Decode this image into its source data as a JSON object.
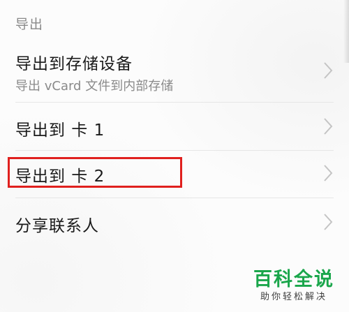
{
  "section": {
    "header": "导出"
  },
  "rows": [
    {
      "title": "导出到存储设备",
      "subtitle": "导出 vCard 文件到内部存储",
      "icon": "chevron-right-icon"
    },
    {
      "title": "导出到 卡 1",
      "icon": "chevron-right-icon"
    },
    {
      "title": "导出到 卡 2",
      "icon": "chevron-right-icon",
      "highlighted": true
    },
    {
      "title": "分享联系人",
      "icon": "chevron-right-icon"
    }
  ],
  "highlight_color": "#e0201e",
  "watermark": {
    "title": "百科全说",
    "subtitle": "助你轻松解决",
    "color": "#1aa64b"
  }
}
